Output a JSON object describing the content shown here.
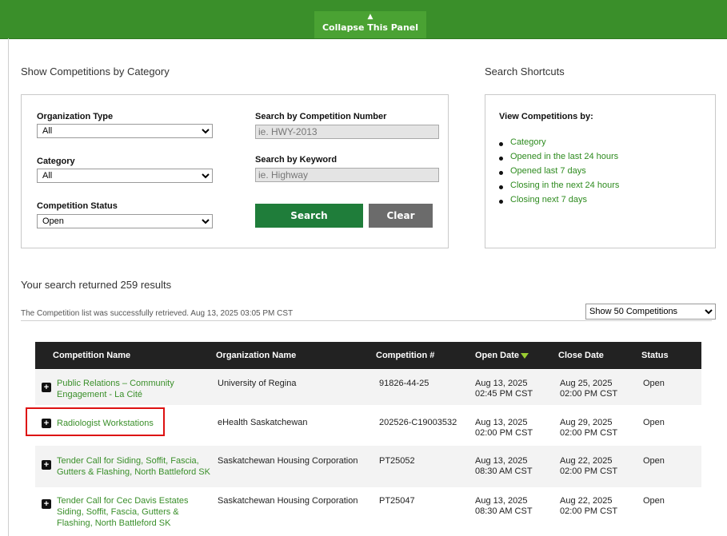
{
  "top": {
    "collapse_label": "Collapse This Panel",
    "collapse_arrow": "▲"
  },
  "categories": {
    "heading": "Show Competitions by Category",
    "org_type": {
      "label": "Organization Type",
      "value": "All"
    },
    "category": {
      "label": "Category",
      "value": "All"
    },
    "status": {
      "label": "Competition Status",
      "value": "Open"
    },
    "comp_number": {
      "label": "Search by Competition Number",
      "placeholder": "ie. HWY-2013"
    },
    "keyword": {
      "label": "Search by Keyword",
      "placeholder": "ie. Highway"
    },
    "search_button": "Search",
    "clear_button": "Clear"
  },
  "shortcuts": {
    "heading": "Search Shortcuts",
    "subheading": "View Competitions by:",
    "items": [
      "Category",
      "Opened in the last 24 hours",
      "Opened last 7 days",
      "Closing in the next 24 hours",
      "Closing next 7 days"
    ]
  },
  "results": {
    "summary": "Your search returned 259 results",
    "status_msg": "The Competition list was successfully retrieved. Aug 13, 2025 03:05 PM CST",
    "page_size": "Show 50 Competitions"
  },
  "table": {
    "headers": [
      "Competition Name",
      "Organization Name",
      "Competition #",
      "Open Date",
      "Close Date",
      "Status"
    ],
    "rows": [
      {
        "name": "Public Relations – Community Engagement - La Cité",
        "org": "University of Regina",
        "number": "91826-44-25",
        "open_date": "Aug 13, 2025",
        "open_time": "02:45 PM CST",
        "close_date": "Aug 25, 2025",
        "close_time": "02:00 PM CST",
        "status": "Open"
      },
      {
        "name": "Radiologist Workstations",
        "org": "eHealth Saskatchewan",
        "number": "202526-C19003532",
        "open_date": "Aug 13, 2025",
        "open_time": "02:00 PM CST",
        "close_date": "Aug 29, 2025",
        "close_time": "02:00 PM CST",
        "status": "Open"
      },
      {
        "name": "Tender Call for Siding, Soffit, Fascia, Gutters & Flashing, North Battleford SK",
        "org": "Saskatchewan Housing Corporation",
        "number": "PT25052",
        "open_date": "Aug 13, 2025",
        "open_time": "08:30 AM CST",
        "close_date": "Aug 22, 2025",
        "close_time": "02:00 PM CST",
        "status": "Open"
      },
      {
        "name": "Tender Call for Cec Davis Estates Siding, Soffit, Fascia, Gutters & Flashing, North Battleford SK",
        "org": "Saskatchewan Housing Corporation",
        "number": "PT25047",
        "open_date": "Aug 13, 2025",
        "open_time": "08:30 AM CST",
        "close_date": "Aug 22, 2025",
        "close_time": "02:00 PM CST",
        "status": "Open"
      }
    ]
  },
  "colors": {
    "brand_green": "#3a8f2a",
    "link_green": "#2e8b1f",
    "header_dark": "#222222",
    "highlight_red": "#dd1111"
  }
}
